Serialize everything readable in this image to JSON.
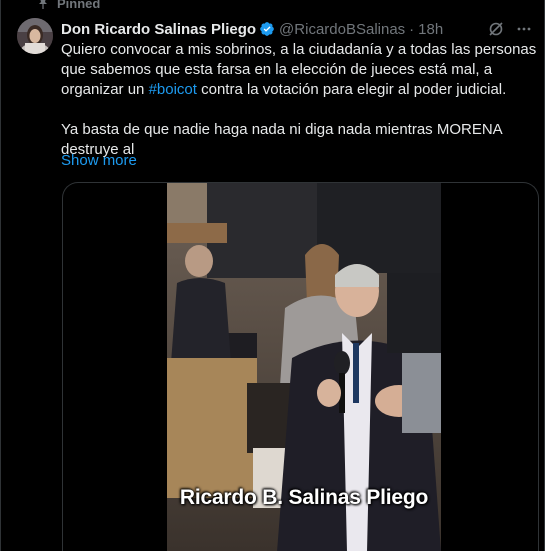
{
  "post": {
    "pinned_label": "Pinned",
    "author": {
      "display_name": "Don Ricardo Salinas Pliego",
      "handle": "@RicardoBSalinas",
      "verified": true
    },
    "separator": "·",
    "timestamp": "18h",
    "text_part1": "Quiero convocar a mis sobrinos, a la ciudadanía y a todas las personas que sabemos que esta farsa en la elección de jueces está mal, a organizar un ",
    "hashtag": "#boicot",
    "text_part2": " contra la votación para elegir al poder judicial.",
    "text_para2": "Ya basta de que nadie haga nada ni diga nada mientras MORENA destruye al",
    "show_more_label": "Show more",
    "media": {
      "caption": "Ricardo B. Salinas Pliego"
    }
  },
  "icons": {
    "pin": "pin-icon",
    "verified": "verified-badge-icon",
    "grok": "grok-icon",
    "more": "more-options-icon"
  },
  "colors": {
    "background": "#000000",
    "text": "#e7e9ea",
    "secondary_text": "#71767b",
    "link": "#1d9bf0",
    "border": "#2f3336"
  }
}
